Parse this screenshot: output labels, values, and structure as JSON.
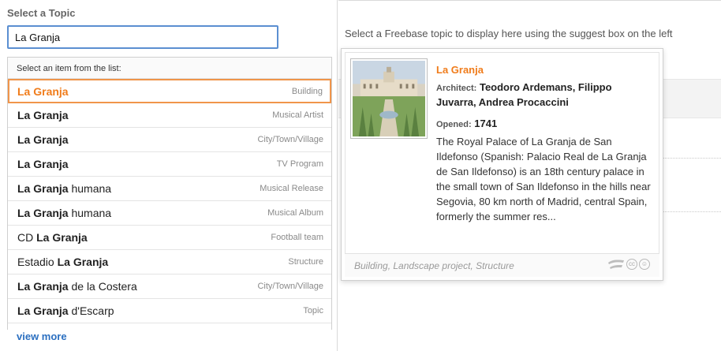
{
  "left": {
    "label": "Select a Topic",
    "search_value": "La Granja"
  },
  "suggest": {
    "header": "Select an item from the list:",
    "items": [
      {
        "prefix": "",
        "bold": "La Granja",
        "suffix": "",
        "type": "Building",
        "highlight": true
      },
      {
        "prefix": "",
        "bold": "La Granja",
        "suffix": "",
        "type": "Musical Artist"
      },
      {
        "prefix": "",
        "bold": "La Granja",
        "suffix": "",
        "type": "City/Town/Village"
      },
      {
        "prefix": "",
        "bold": "La Granja",
        "suffix": "",
        "type": "TV Program"
      },
      {
        "prefix": "",
        "bold": "La Granja",
        "suffix": " humana",
        "type": "Musical Release"
      },
      {
        "prefix": "",
        "bold": "La Granja",
        "suffix": " humana",
        "type": "Musical Album"
      },
      {
        "prefix": "CD ",
        "bold": "La Granja",
        "suffix": "",
        "type": "Football team"
      },
      {
        "prefix": "Estadio ",
        "bold": "La Granja",
        "suffix": "",
        "type": "Structure"
      },
      {
        "prefix": "",
        "bold": "La Granja",
        "suffix": " de la Costera",
        "type": "City/Town/Village"
      },
      {
        "prefix": "",
        "bold": "La Granja",
        "suffix": " d'Escarp",
        "type": "Topic"
      }
    ],
    "view_more": "view more"
  },
  "main": {
    "instructions": "Select a Freebase topic to display here using the suggest box on the left"
  },
  "card": {
    "title": "La Granja",
    "architect_label": "Architect:",
    "architect_value": "Teodoro Ardemans, Filippo Juvarra, Andrea Procaccini",
    "opened_label": "Opened:",
    "opened_value": "1741",
    "description": "The Royal Palace of La Granja de San Ildefonso (Spanish: Palacio Real de La Granja de San Ildefonso) is an 18th century palace in the small town of San Ildefonso in the hills near Segovia, 80 km north of Madrid, central Spain, formerly the summer res...",
    "footer_types": "Building, Landscape project, Structure",
    "footer_icons": [
      "freebase-icon",
      "creative-commons-icon",
      "attribution-icon"
    ],
    "cc_glyph": "cc",
    "by_glyph": "☺"
  },
  "colors": {
    "accent_orange": "#f07c1b",
    "input_border": "#5b8fd1",
    "link_blue": "#2b6fc0"
  }
}
